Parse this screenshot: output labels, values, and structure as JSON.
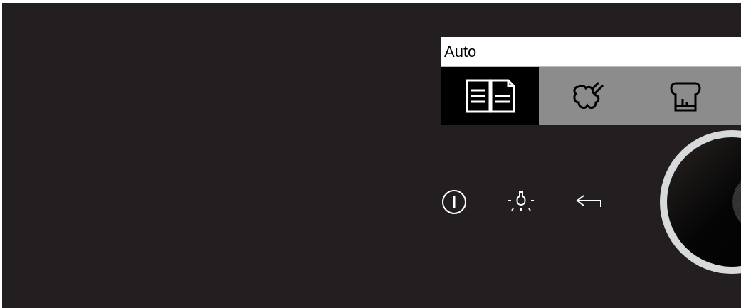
{
  "display": {
    "title": "Auto",
    "tabs": [
      {
        "kind": "book",
        "selected": true
      },
      {
        "kind": "steam",
        "selected": false
      },
      {
        "kind": "chef",
        "selected": false
      }
    ]
  },
  "buttons": [
    {
      "kind": "power"
    },
    {
      "kind": "light"
    },
    {
      "kind": "back"
    }
  ]
}
